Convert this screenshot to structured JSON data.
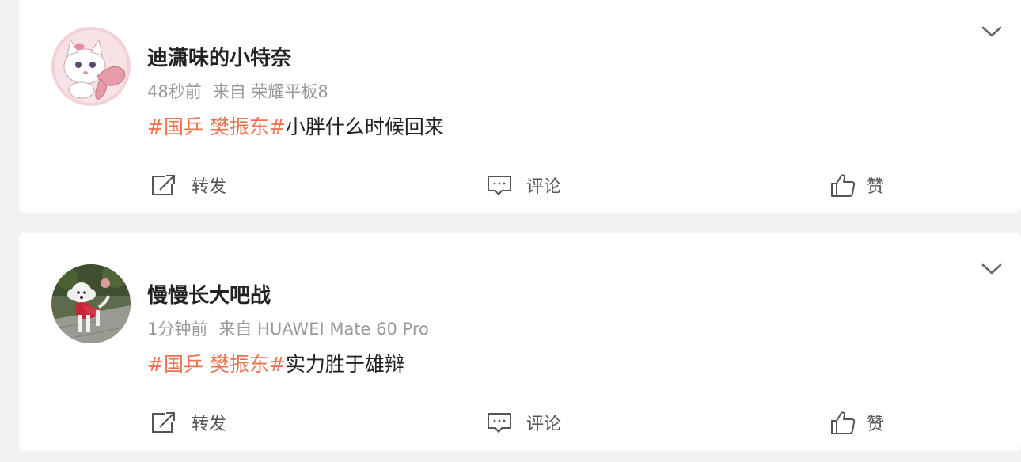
{
  "posts": [
    {
      "username": "迪潇味的小特奈",
      "time": "48秒前",
      "source": "来自 荣耀平板8",
      "topic": "#国乒 樊振东#",
      "text": "小胖什么时候回来",
      "actions": {
        "repost": "转发",
        "comment": "评论",
        "like": "赞"
      }
    },
    {
      "username": "慢慢长大吧战",
      "time": "1分钟前",
      "source": "来自 HUAWEI Mate 60 Pro",
      "topic": "#国乒 樊振东#",
      "text": "实力胜于雄辩",
      "actions": {
        "repost": "转发",
        "comment": "评论",
        "like": "赞"
      }
    }
  ],
  "colors": {
    "topic": "#eb7350",
    "username": "#222222",
    "meta": "#999999",
    "action_text": "#555555",
    "background": "#f2f2f2",
    "card": "#ffffff"
  },
  "icons": {
    "repost": "share-icon",
    "comment": "comment-icon",
    "like": "thumbs-up-icon",
    "menu": "chevron-down-icon"
  }
}
